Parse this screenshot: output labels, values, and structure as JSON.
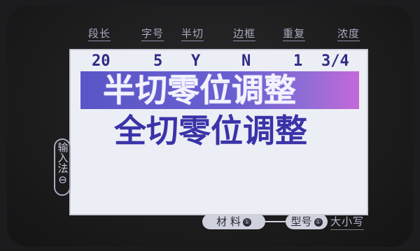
{
  "top_labels": [
    "段长",
    "字号",
    "半切",
    "边框",
    "重复",
    "浓度"
  ],
  "values": [
    "20",
    "5",
    "Y",
    "N",
    "1",
    "3/4"
  ],
  "menu": {
    "selected_item": "半切零位调整",
    "second_item": "全切零位调整",
    "highlight_color": "#5a56c7"
  },
  "side_key": {
    "label": "输入法",
    "symbol": "⊖"
  },
  "bottom_keys": {
    "material_label": "材 料",
    "material_dot": "①",
    "model_label": "型号",
    "model_dot": "①",
    "size_label": "大小写"
  }
}
